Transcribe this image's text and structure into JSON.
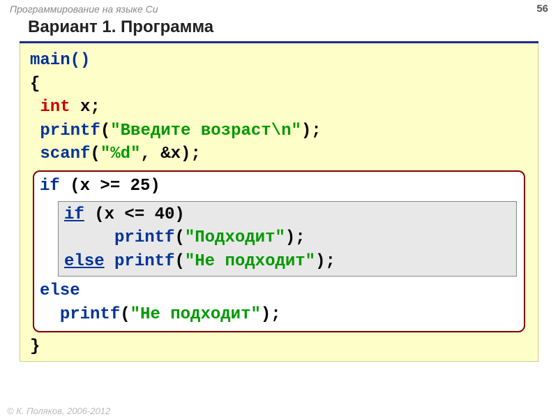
{
  "header": {
    "course": "Программирование на языке Си",
    "page": "56"
  },
  "title": "Вариант 1. Программа",
  "code": {
    "l1_a": "main()",
    "l2_a": "{",
    "l3_pad": " ",
    "l3_type": "int",
    "l3_rest": " x;",
    "l4_pad": " ",
    "l4_kw": "printf",
    "l4_open": "(",
    "l4_str": "\"Введите возраст\\n\"",
    "l4_close": ");",
    "l5_pad": " ",
    "l5_kw": "scanf",
    "l5_open": "(",
    "l5_str": "\"%d\"",
    "l5_rest": ", &x);",
    "outer": {
      "l1_kw": "if",
      "l1_rest": " (x >= 25)",
      "inner": {
        "l1_kw": "if",
        "l1_rest": " (x <= 40)",
        "l2_pad": "     ",
        "l2_kw": "printf",
        "l2_open": "(",
        "l2_str": "\"Подходит\"",
        "l2_close": ");",
        "l3_kw": "else",
        "l3_sp": " ",
        "l3_kw2": "printf",
        "l3_open": "(",
        "l3_str": "\"Не подходит\"",
        "l3_close": ");"
      },
      "l3_kw": "else",
      "l4_pad": "  ",
      "l4_kw": "printf",
      "l4_open": "(",
      "l4_str": "\"Не подходит\"",
      "l4_close": ");"
    },
    "lend": "}"
  },
  "footer": "© К. Поляков, 2006-2012"
}
